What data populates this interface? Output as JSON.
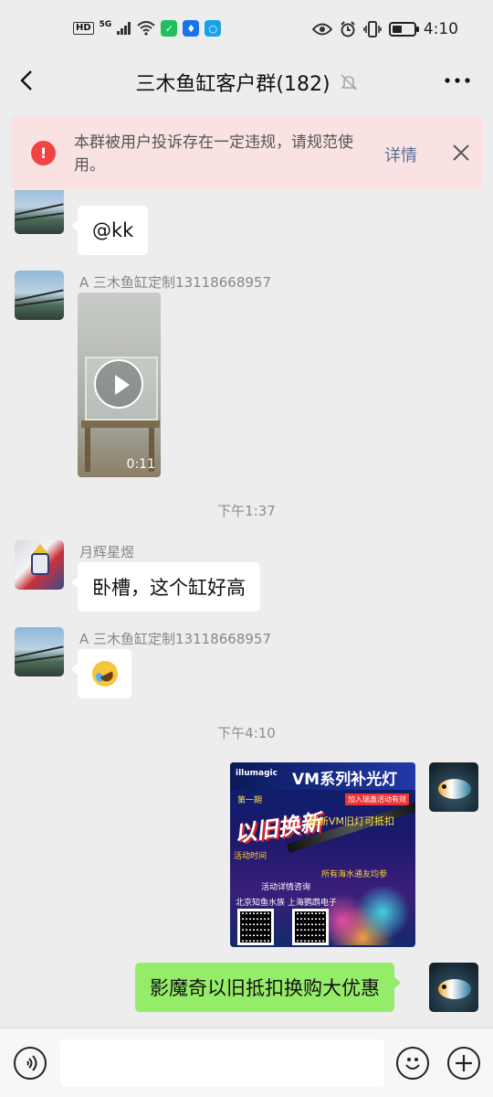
{
  "status_bar": {
    "network_badge": "HD",
    "network_gen": "5G",
    "time": "4:10",
    "battery_percent": 45,
    "app_icons": [
      "wechat-icon",
      "bulb-icon",
      "search-app-icon"
    ],
    "indicator_icons": [
      "eye-icon",
      "alarm-icon",
      "vibrate-icon"
    ]
  },
  "header": {
    "title": "三木鱼缸客户群(182)",
    "mute_icon": "bell-off-icon",
    "back_icon": "chevron-left-icon",
    "more_icon": "more-dots-icon"
  },
  "warning": {
    "text": "本群被用户投诉存在一定违规，请规范使用。",
    "detail_label": "详情",
    "icon_symbol": "!",
    "accent_color": "#f04343"
  },
  "messages": {
    "m1": {
      "text": "@kk"
    },
    "m2": {
      "sender": "A 三木鱼缸定制13118668957",
      "video_duration": "0:11"
    },
    "t1": "下午1:37",
    "m3": {
      "sender": "月辉星煜",
      "text": "卧槽，这个缸好高"
    },
    "m4": {
      "sender": "A 三木鱼缸定制13118668957",
      "emoji": "laughing-crying-emoji"
    },
    "t2": "下午4:10",
    "m5": {
      "poster": {
        "brand": "illumagic",
        "title": "VM系列补光灯",
        "banner": "以旧换新",
        "subtitle": "买新VM旧灯可抵扣",
        "tag": "加入瑞鑫活动有效",
        "period": "第一期",
        "activity": "活动时间",
        "scope": "所有海水通友均参",
        "contact": "活动详情咨询",
        "shops": "北京知鱼水族  上海鹦鹉电子"
      }
    },
    "m6": {
      "text": "影魔奇以旧抵扣换购大优惠"
    }
  },
  "input_bar": {
    "value": "",
    "voice_icon": "voice-icon",
    "emoji_icon": "emoji-icon",
    "plus_icon": "plus-icon"
  },
  "colors": {
    "background": "#ededed",
    "self_bubble": "#95ec69",
    "other_bubble": "#ffffff"
  }
}
